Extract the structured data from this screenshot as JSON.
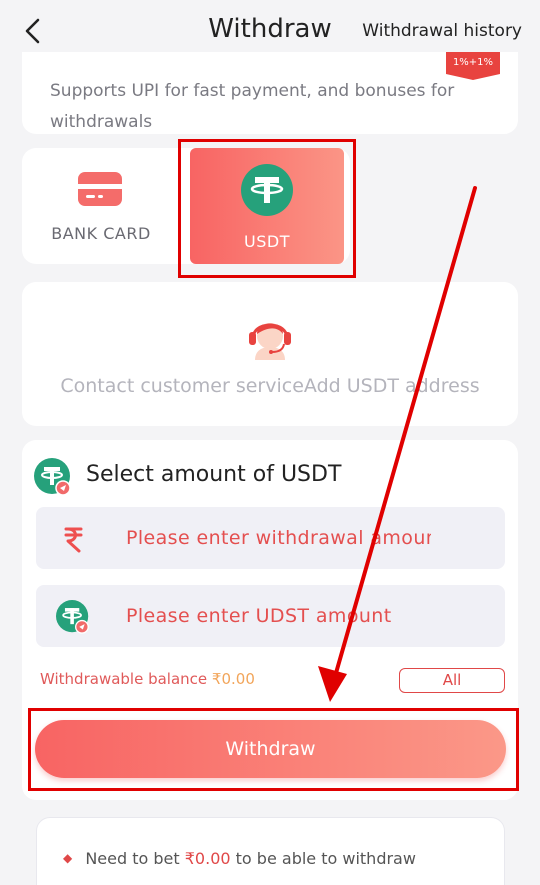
{
  "header": {
    "title": "Withdraw",
    "history_label": "Withdrawal history"
  },
  "upi": {
    "description": "Supports UPI for fast payment, and bonuses for withdrawals",
    "badge_text": "1%+1%"
  },
  "methods": {
    "bank_label": "BANK CARD",
    "usdt_label": "USDT"
  },
  "contact": {
    "text": "Contact customer serviceAdd USDT address"
  },
  "amount": {
    "title": "Select amount of USDT",
    "withdrawal_placeholder": "Please enter withdrawal amount",
    "usdt_placeholder": "Please enter UDST amount",
    "balance_label": "Withdrawable balance",
    "balance_value": "₹0.00",
    "all_label": "All"
  },
  "withdraw_button": "Withdraw",
  "notes": {
    "prefix": "Need to bet",
    "amount": "₹0.00",
    "suffix": "to be able to withdraw"
  },
  "colors": {
    "accent_start": "#f86463",
    "accent_end": "#fb9586",
    "usdt_green": "#26a17b",
    "annotation_red": "#e00000"
  }
}
